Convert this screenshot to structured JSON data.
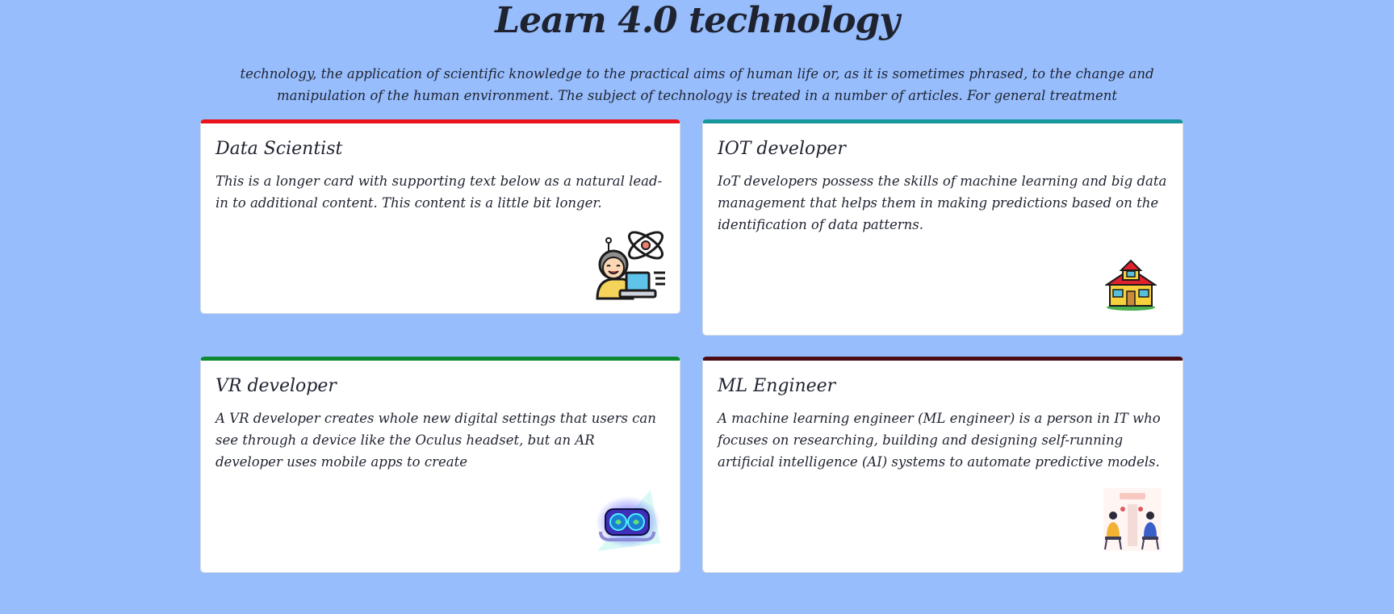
{
  "header": {
    "title": "Learn 4.0 technology",
    "description": "technology, the application of scientific knowledge to the practical aims of human life or, as it is sometimes phrased, to the change and manipulation of the human environment. The subject of technology is treated in a number of articles. For general treatment"
  },
  "theme": {
    "background": "#97bdfd",
    "card_background": "#ffffff",
    "text": "#1f2330"
  },
  "cards": [
    {
      "title": "Data Scientist",
      "text": "This is a longer card with supporting text below as a natural lead-in to additional content. This content is a little bit longer.",
      "accent": "#e8131b",
      "icon": "data-scientist-illustration"
    },
    {
      "title": "IOT developer",
      "text": "IoT developers possess the skills of machine learning and big data management that helps them in making predictions based on the identification of data patterns.",
      "accent": "#17969b",
      "icon": "smart-house-illustration"
    },
    {
      "title": "VR developer",
      "text": "A VR developer creates whole new digital settings that users can see through a device like the Oculus headset, but an AR developer uses mobile apps to create",
      "accent": "#0c8a32",
      "icon": "vr-headset-illustration"
    },
    {
      "title": "ML Engineer",
      "text": "A machine learning engineer (ML engineer) is a person in IT who focuses on researching, building and designing self-running artificial intelligence (AI) systems to automate predictive models.",
      "accent": "#4a0d14",
      "icon": "podcast-illustration"
    }
  ]
}
